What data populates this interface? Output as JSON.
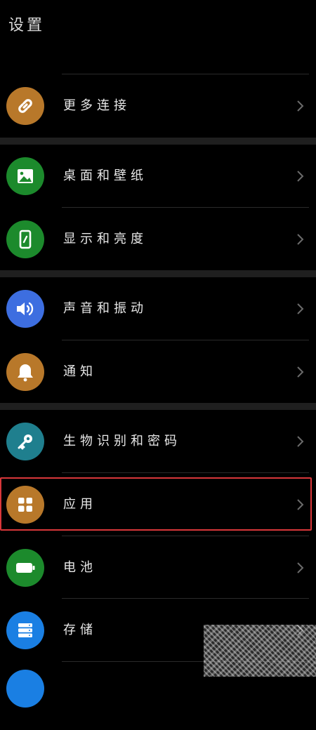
{
  "header": {
    "title": "设置"
  },
  "colors": {
    "background": "#000000",
    "group_gap": "#1f1f1f",
    "divider": "#2a2a2a",
    "highlight_border": "#d9373a",
    "orange": "#b8782a",
    "green": "#1c8a2c",
    "blue": "#3d6ee0",
    "teal": "#1f7f8e",
    "cyan_blue": "#1a7fe3"
  },
  "items": [
    {
      "label": "",
      "icon": "partial-green-icon",
      "color": "#1c8a2c"
    },
    {
      "label": "更多连接",
      "icon": "link-icon",
      "color": "#b8782a"
    },
    {
      "label": "桌面和壁纸",
      "icon": "image-icon",
      "color": "#1c8a2c"
    },
    {
      "label": "显示和亮度",
      "icon": "phone-display-icon",
      "color": "#1c8a2c"
    },
    {
      "label": "声音和振动",
      "icon": "speaker-icon",
      "color": "#3d6ee0"
    },
    {
      "label": "通知",
      "icon": "bell-icon",
      "color": "#b8782a"
    },
    {
      "label": "生物识别和密码",
      "icon": "key-icon",
      "color": "#1f7f8e"
    },
    {
      "label": "应用",
      "icon": "apps-grid-icon",
      "color": "#b8782a"
    },
    {
      "label": "电池",
      "icon": "battery-icon",
      "color": "#1c8a2c"
    },
    {
      "label": "存储",
      "icon": "storage-icon",
      "color": "#1a7fe3"
    }
  ]
}
